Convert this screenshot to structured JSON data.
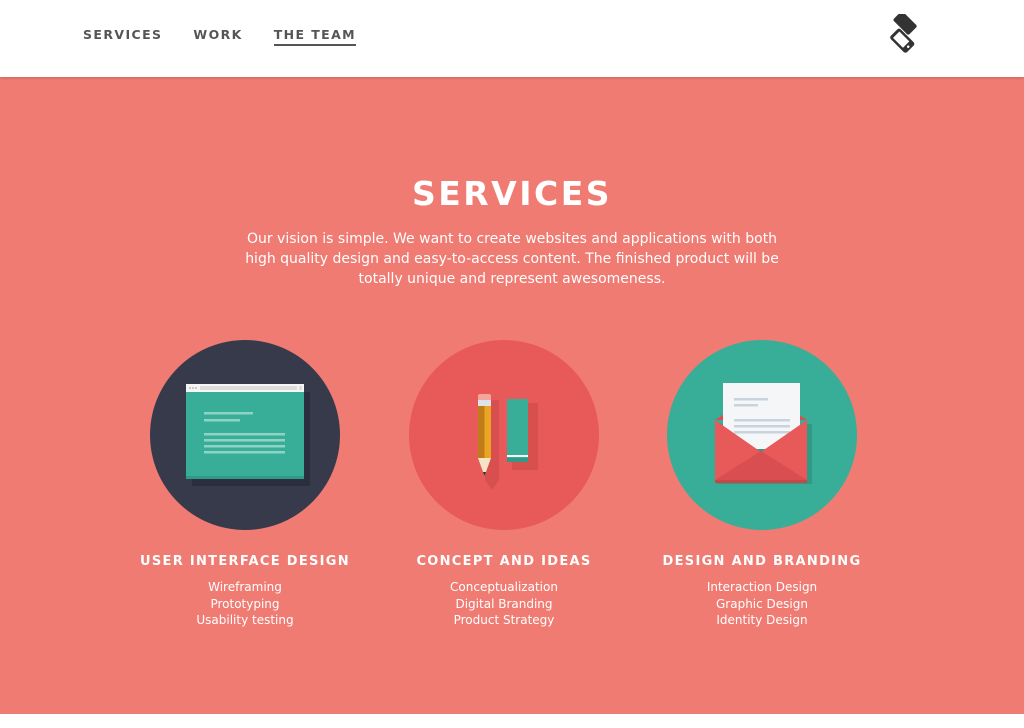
{
  "nav": {
    "items": [
      {
        "label": "SERVICES",
        "active": false
      },
      {
        "label": "WORK",
        "active": false
      },
      {
        "label": "THE TEAM",
        "active": true
      }
    ],
    "logo_icon": "rotated-phones-logo-icon"
  },
  "services": {
    "title": "SERVICES",
    "intro_lines": [
      "Our vision is simple. We want to create websites and applications with both",
      "high quality design and easy-to-access content. The finished product will be",
      "totally unique and represent awesomeness."
    ],
    "cards": [
      {
        "icon": "browser-window-icon",
        "circle_color": "#363a4b",
        "title": "USER INTERFACE DESIGN",
        "items": [
          "Wireframing",
          "Prototyping",
          "Usability testing"
        ]
      },
      {
        "icon": "pencil-and-eraser-icon",
        "circle_color": "#e8595a",
        "title": "CONCEPT AND IDEAS",
        "items": [
          "Conceptualization",
          "Digital Branding",
          "Product Strategy"
        ]
      },
      {
        "icon": "open-envelope-letter-icon",
        "circle_color": "#38ad97",
        "title": "DESIGN AND BRANDING",
        "items": [
          "Interaction Design",
          "Graphic Design",
          "Identity Design"
        ]
      }
    ]
  },
  "colors": {
    "background": "#f07b72",
    "nav_text": "#555555",
    "teal": "#38ad97",
    "navy": "#363a4b",
    "red": "#e8595a"
  }
}
